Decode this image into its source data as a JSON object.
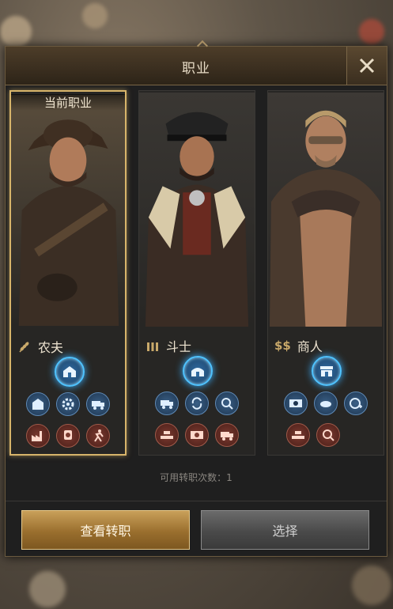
{
  "dialog": {
    "title": "职业",
    "current_label": "当前职业",
    "remaining_text": "可用转职次数：1",
    "view_button": "查看转职",
    "select_button": "选择"
  },
  "jobs": [
    {
      "name": "农夫",
      "icon": "wheat-icon",
      "selected": true,
      "main_feature": "farm-icon",
      "row1": [
        "storehouse-icon",
        "gear-icon",
        "truck-icon"
      ],
      "row2": [
        "factory-icon",
        "medal-icon",
        "runner-icon"
      ]
    },
    {
      "name": "斗士",
      "icon": "bullets-icon",
      "selected": false,
      "main_feature": "barracks-icon",
      "row1": [
        "convoy-icon",
        "swap-icon",
        "search-icon"
      ],
      "row2": [
        "gold-bars-icon",
        "cash-icon",
        "truck-icon"
      ]
    },
    {
      "name": "商人",
      "icon": "dollar-icon",
      "selected": false,
      "icon_text": "$$",
      "main_feature": "shop-icon",
      "row1": [
        "cash-icon",
        "bread-icon",
        "coin-plus-icon"
      ],
      "row2": [
        "gold-bars-icon",
        "search-icon"
      ]
    }
  ],
  "colors": {
    "gold": "#d7b46a",
    "accent_blue": "#4fc3ff",
    "panel": "#1f1f1f"
  }
}
